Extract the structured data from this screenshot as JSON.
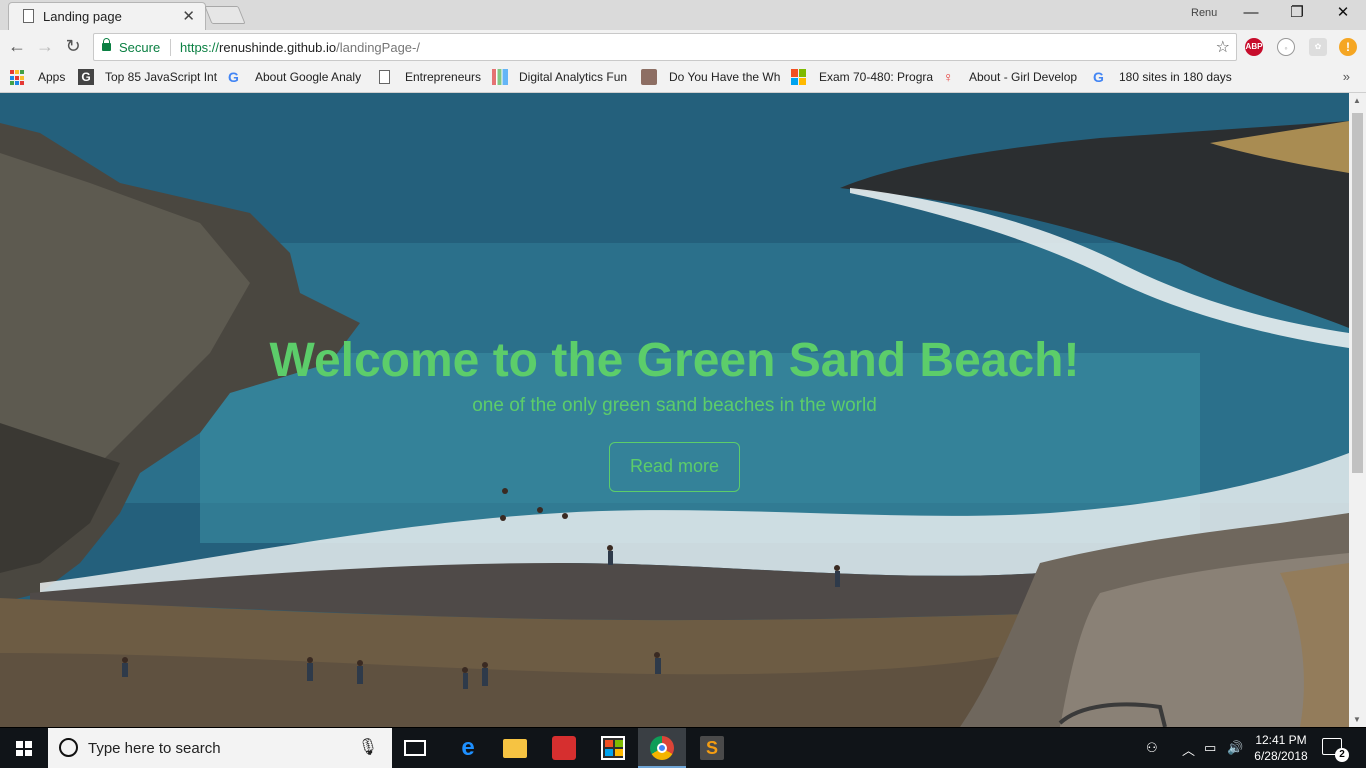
{
  "browser": {
    "tab_title": "Landing page",
    "tab_close": "✕",
    "user_name": "Renu",
    "window_controls": {
      "minimize": "—",
      "restore": "❐",
      "close": "✕"
    },
    "nav": {
      "back": "←",
      "forward": "→",
      "reload": "↻"
    },
    "secure_label": "Secure",
    "url_scheme": "https://",
    "url_host": "renushinde.github.io",
    "url_path": "/landingPage-/",
    "bookmark_star": "☆",
    "extensions": {
      "abp": "ABP",
      "update_badge": "!"
    },
    "bookmarks": [
      "Apps",
      "Top 85 JavaScript Int",
      "About Google Analy",
      "Entrepreneurs",
      "Digital Analytics Fun",
      "Do You Have the Wh",
      "Exam 70-480: Progra",
      "About - Girl Develop",
      "180 sites in 180 days"
    ],
    "bookmarks_more": "»"
  },
  "hero": {
    "title": "Welcome to the Green Sand Beach!",
    "subtitle": "one of the only green sand beaches in the world",
    "button_label": "Read more",
    "accent_color": "#5ccd6a"
  },
  "taskbar": {
    "search_placeholder": "Type here to search",
    "time": "12:41 PM",
    "date": "6/28/2018",
    "notification_count": "2",
    "pinned_icons": [
      "task-view-icon",
      "edge-icon",
      "file-explorer-icon",
      "reader-icon",
      "store-icon",
      "chrome-icon",
      "sublime-text-icon"
    ]
  }
}
